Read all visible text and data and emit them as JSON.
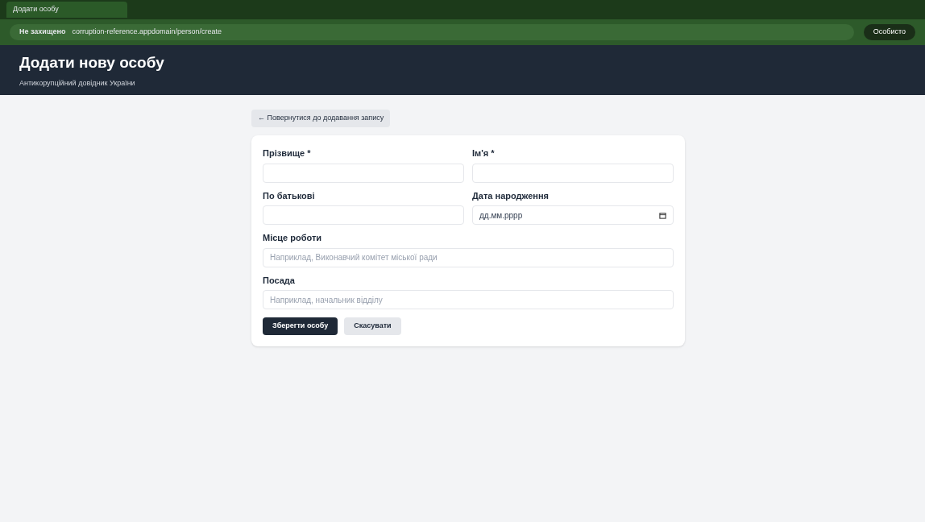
{
  "browser": {
    "tab_title": "Додати особу",
    "security": "Не захищено",
    "url": "corruption-reference.appdomain/person/create",
    "profile": "Особисто"
  },
  "header": {
    "title": "Додати нову особу",
    "subtitle": "Антикорупційний довідник України"
  },
  "back_link": "← Повернутися до додавання запису",
  "form_rows": [
    [
      {
        "label": "Прізвище *",
        "kind": "text"
      },
      {
        "label": "Ім'я *",
        "kind": "text"
      }
    ],
    [
      {
        "label": "По батькові",
        "kind": "text"
      },
      {
        "label": "Дата народження",
        "kind": "date",
        "value": "дд.мм.рррр"
      }
    ],
    [
      {
        "label": "Місце роботи",
        "kind": "text",
        "placeholder": "Наприклад, Виконавчий комітет міської ради"
      }
    ],
    [
      {
        "label": "Посада",
        "kind": "text",
        "placeholder": "Наприклад, начальник відділу"
      }
    ]
  ],
  "buttons": [
    {
      "label": "Зберегти особу",
      "kind": "primary"
    },
    {
      "label": "Скасувати",
      "kind": "secondary"
    }
  ]
}
